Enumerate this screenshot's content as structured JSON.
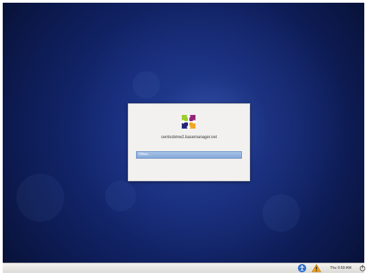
{
  "login": {
    "hostname": "centosbmw2.basemanager.net",
    "user_item": "Other..."
  },
  "panel": {
    "clock": "Thu 9:59 AM",
    "icons": [
      "accessibility-icon",
      "warning-icon",
      "power-icon"
    ]
  },
  "colors": {
    "desktop_blue": "#162b78",
    "dialog_bg": "#f2f1ef",
    "selection_blue": "#86a8d8",
    "accessibility_blue": "#2f6fc9",
    "warning_orange": "#f0a020"
  }
}
